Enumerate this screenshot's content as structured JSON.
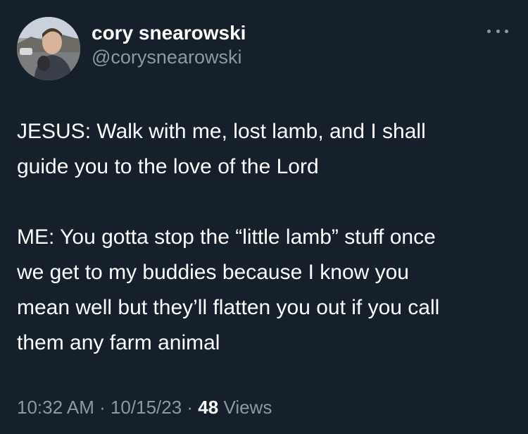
{
  "colors": {
    "background": "#15202b",
    "primary_text": "#ffffff",
    "secondary_text": "#8b98a5"
  },
  "author": {
    "display_name": "cory snearowski",
    "handle": "@corysnearowski"
  },
  "more_menu": {
    "icon": "more-horizontal-icon"
  },
  "tweet": {
    "paragraph_1_line_1": "JESUS: Walk with me, lost lamb, and I shall",
    "paragraph_1_line_2": "guide you to the love of the Lord",
    "paragraph_2_line_1": "ME: You gotta stop the “little lamb” stuff once",
    "paragraph_2_line_2": "we get to my buddies because I know you",
    "paragraph_2_line_3": "mean well but they’ll flatten you out if you call",
    "paragraph_2_line_4": "them any farm animal"
  },
  "meta": {
    "time": "10:32 AM",
    "separator": " · ",
    "date": "10/15/23",
    "views_count": "48",
    "views_label": " Views"
  }
}
